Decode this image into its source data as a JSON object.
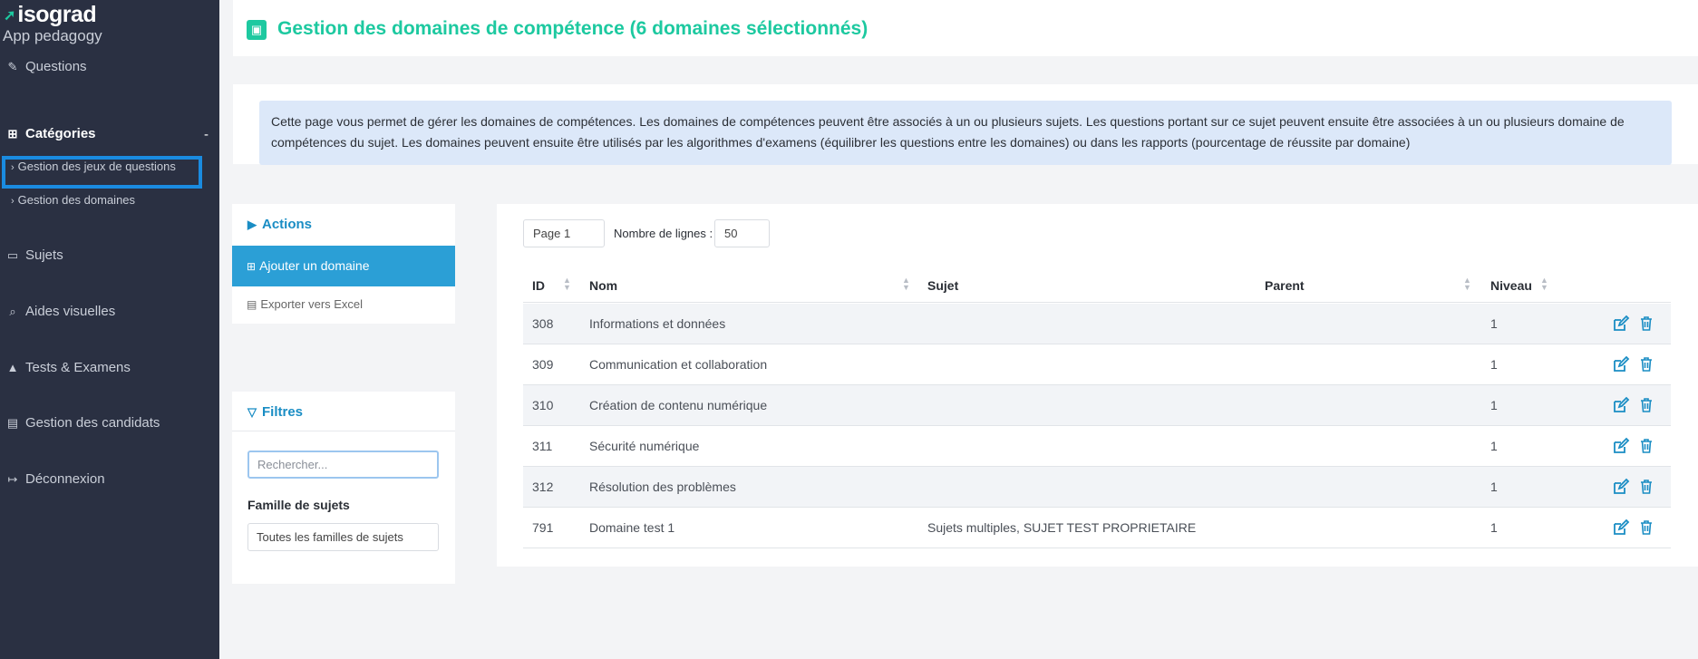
{
  "sidebar": {
    "logo_text": "isograd",
    "app_name": "App pedagogy",
    "items": [
      {
        "label": "Questions",
        "icon": "edit-square-icon"
      },
      {
        "label": "Catégories",
        "icon": "sitemap-icon",
        "expanded_sign": "-"
      },
      {
        "label": "Sujets",
        "icon": "folder-open-icon"
      },
      {
        "label": "Aides visuelles",
        "icon": "search-icon"
      },
      {
        "label": "Tests & Examens",
        "icon": "graduation-cap-icon"
      },
      {
        "label": "Gestion des candidats",
        "icon": "id-card-icon"
      },
      {
        "label": "Déconnexion",
        "icon": "sign-out-icon"
      }
    ],
    "sub_items": [
      {
        "label": "Gestion des jeux de questions"
      },
      {
        "label": "Gestion des domaines"
      }
    ]
  },
  "header": {
    "title": "Gestion des domaines de compétence (6 domaines sélectionnés)",
    "icon": "briefcase-icon"
  },
  "info": {
    "text": "Cette page vous permet de gérer les domaines de compétences. Les domaines de compétences peuvent être associés à un ou plusieurs sujets. Les questions portant sur ce sujet peuvent ensuite être associées à un ou plusieurs domaine de compétences du sujet. Les domaines peuvent ensuite être utilisés par les algorithmes d'examens (équilibrer les questions entre les domaines) ou dans les rapports (pourcentage de réussite par domaine)"
  },
  "actions": {
    "title": "Actions",
    "add_label": "Ajouter un domaine",
    "export_label": "Exporter vers Excel"
  },
  "filters": {
    "title": "Filtres",
    "search_placeholder": "Rechercher...",
    "family_label": "Famille de sujets",
    "family_value": "Toutes les familles de sujets"
  },
  "table": {
    "page_value": "Page 1",
    "rows_label": "Nombre de lignes :",
    "rows_value": "50",
    "headers": {
      "id": "ID",
      "nom": "Nom",
      "sujet": "Sujet",
      "parent": "Parent",
      "niveau": "Niveau"
    },
    "rows": [
      {
        "id": "308",
        "nom": "Informations et données",
        "sujet": "",
        "parent": "",
        "niveau": "1"
      },
      {
        "id": "309",
        "nom": "Communication et collaboration",
        "sujet": "",
        "parent": "",
        "niveau": "1"
      },
      {
        "id": "310",
        "nom": "Création de contenu numérique",
        "sujet": "",
        "parent": "",
        "niveau": "1"
      },
      {
        "id": "311",
        "nom": "Sécurité numérique",
        "sujet": "",
        "parent": "",
        "niveau": "1"
      },
      {
        "id": "312",
        "nom": "Résolution des problèmes",
        "sujet": "",
        "parent": "",
        "niveau": "1"
      },
      {
        "id": "791",
        "nom": "Domaine test 1",
        "sujet": "Sujets multiples, SUJET TEST PROPRIETAIRE",
        "parent": "",
        "niveau": "1"
      }
    ]
  },
  "colors": {
    "sidebar_bg": "#2a3042",
    "accent_green": "#1dc9a0",
    "accent_blue": "#2b9fd6",
    "info_bg": "#dce8f9",
    "highlight": "#1a8be0"
  }
}
